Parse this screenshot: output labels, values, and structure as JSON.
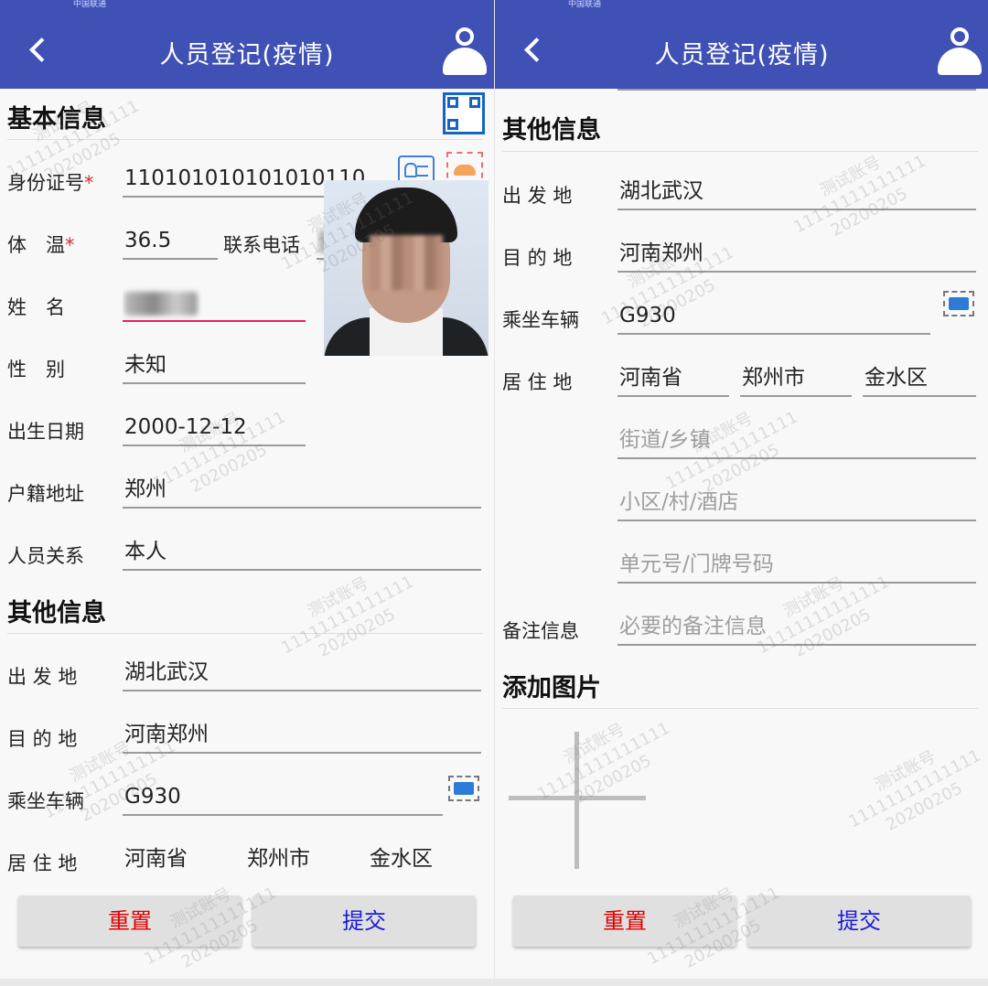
{
  "statusbar": {
    "carrier": "中国联通"
  },
  "appbar": {
    "title": "人员登记(疫情)"
  },
  "sections": {
    "basic": "基本信息",
    "other": "其他信息",
    "pictures": "添加图片"
  },
  "basic": {
    "id_label": "身份证号",
    "id_value": "110101010101010110",
    "temp_label": "体　温",
    "temp_value": "36.5",
    "phone_label": "联系电话",
    "name_label": "姓　名",
    "gender_label": "性　别",
    "gender_value": "未知",
    "birth_label": "出生日期",
    "birth_value": "2000-12-12",
    "address_label": "户籍地址",
    "address_value": "郑州",
    "relation_label": "人员关系",
    "relation_value": "本人"
  },
  "other": {
    "from_label": "出 发 地",
    "from_value": "湖北武汉",
    "dest_label": "目 的 地",
    "dest_value": "河南郑州",
    "vehicle_label": "乘坐车辆",
    "vehicle_value": "G930",
    "residence_label": "居 住 地",
    "province": "河南省",
    "city": "郑州市",
    "district": "金水区",
    "street_placeholder": "街道/乡镇",
    "community_placeholder": "小区/村/酒店",
    "unit_placeholder": "单元号/门牌号码",
    "remark_label": "备注信息",
    "remark_placeholder": "必要的备注信息"
  },
  "buttons": {
    "reset": "重置",
    "submit": "提交"
  },
  "watermark": {
    "line1": "测试账号",
    "line2": "11111111111111",
    "line3": "20200205"
  },
  "colors": {
    "appbar": "#3f51b5",
    "required": "#d32f2f",
    "reset": "#e00000",
    "submit": "#1a1ad8"
  }
}
